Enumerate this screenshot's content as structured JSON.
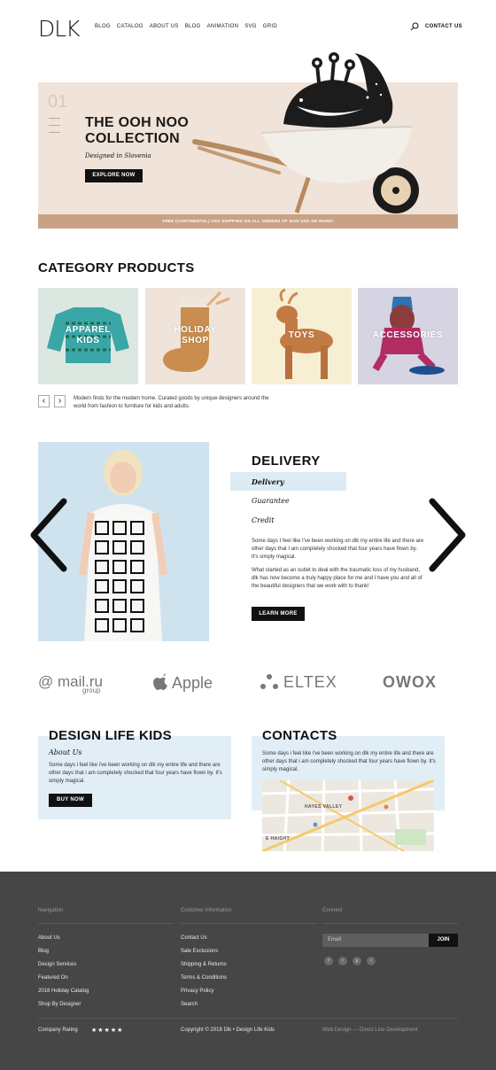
{
  "header": {
    "logo": "DLK",
    "nav": [
      "BLOG",
      "CATALOG",
      "ABOUT US",
      "BLOG",
      "ANIMATION",
      "SVG",
      "GRID"
    ],
    "contact": "CONTACT US",
    "search_icon": "search-icon"
  },
  "hero": {
    "slide_number": "01",
    "title_line1": "THE OOH NOO",
    "title_line2": "COLLECTION",
    "subtitle": "Designed in Slovenia",
    "button": "EXPLORE NOW",
    "banner": "FREE (CONTINENTAL) USA SHIPPING ON ALL ORDERS OF $100 USD OR MORE!"
  },
  "category": {
    "title": "CATEGORY PRODUCTS",
    "tiles": [
      {
        "line1": "APPAREL",
        "line2": "KIDS",
        "bg": "#dde7e2"
      },
      {
        "line1": "HOLIDAY",
        "line2": "SHOP",
        "bg": "#efe3da"
      },
      {
        "line1": "TOYS",
        "line2": "",
        "bg": "#f7efd4"
      },
      {
        "line1": "ACCESSORIES",
        "line2": "",
        "bg": "#d6d3e2"
      }
    ],
    "prev": "‹",
    "next": "›",
    "description": "Modern finds for the modern home. Curated goods by unique designers around the world from fashion to furniture for kids and adults."
  },
  "delivery": {
    "title": "DELIVERY",
    "tabs": [
      "Delivery",
      "Guarantee",
      "Credit"
    ],
    "paragraph1": "Some days I feel like I've been working on dlk my entire life and there are other days that I am completely shocked that four years have flown by. It's simply magical.",
    "paragraph2": "What started as an outlet to deal  with the traumatic loss of my husband, dlk has now become a truly happy place for me and I have you and all of the beautiful designers that we work with to thank!",
    "button": "LEARN MORE"
  },
  "brands": {
    "mail": "@ mail.ru",
    "mail_group": "group",
    "apple": "Apple",
    "eltex": "ELTEX",
    "owox": "OWOX"
  },
  "dlk": {
    "title": "DESIGN LIFE KIDS",
    "subtitle": "About Us",
    "text": "Some days i feel like i've been working on dlk my entire life and there are other days that i am completely shocked that four years have flown by. It's simply magical.",
    "button": "BUY NOW"
  },
  "contacts": {
    "title": "CONTACTS",
    "text": "Some days i feel like i've been working on dlk my entire life and there are other days that i am completely shocked that four years have flown by. It's simply magical.",
    "map_label1": "HAYES VALLEY",
    "map_label2": "E HAIGHT"
  },
  "footer": {
    "nav_head": "Navigation",
    "nav_links": [
      "About Us",
      "Blog",
      "Design Services",
      "Featured On",
      "2018 Holiday Catalog",
      "Shop By Designer"
    ],
    "info_head": "Customer Information",
    "info_links": [
      "Contact Us",
      "Sale Exclusions",
      "Shipping & Returns",
      "Terms & Conditions",
      "Privacy Policy",
      "Search"
    ],
    "connect_head": "Connect",
    "email_placeholder": "Email",
    "join": "JOIN",
    "social": [
      "f",
      "t",
      "p",
      "i"
    ],
    "rating_label": "Company Rating",
    "stars": "★★★★★",
    "rating_value": 5,
    "copyright": "Copyright © 2018 Dlk • Design Life Kids",
    "credit": "Web Design — Direct Line Development"
  }
}
